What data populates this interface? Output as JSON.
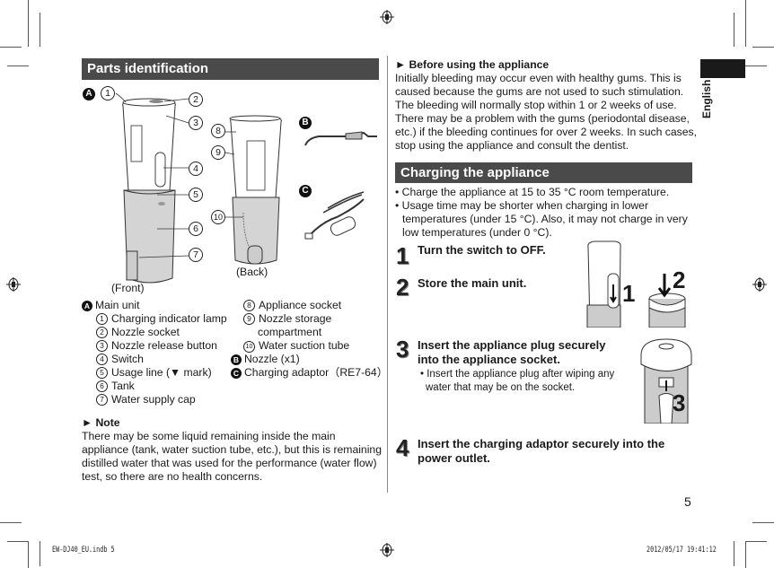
{
  "page": {
    "number": "5",
    "language_tab": "English",
    "footer": {
      "file": "EW-DJ40_EU.indb   5",
      "datetime": "2012/05/17   19:41:12"
    }
  },
  "parts": {
    "heading": "Parts identification",
    "group_labels": {
      "A": "A",
      "B": "B",
      "C": "C"
    },
    "captions": {
      "front": "(Front)",
      "back": "(Back)"
    },
    "callouts": [
      "1",
      "2",
      "3",
      "4",
      "5",
      "6",
      "7",
      "8",
      "9",
      "10"
    ],
    "main_unit_label": "Main unit",
    "items_left": [
      {
        "num": "1",
        "text": "Charging indicator lamp"
      },
      {
        "num": "2",
        "text": "Nozzle socket"
      },
      {
        "num": "3",
        "text": "Nozzle release button"
      },
      {
        "num": "4",
        "text": "Switch"
      },
      {
        "num": "5",
        "text": "Usage line (▼ mark)"
      },
      {
        "num": "6",
        "text": "Tank"
      },
      {
        "num": "7",
        "text": "Water supply cap"
      }
    ],
    "items_right": [
      {
        "num": "8",
        "text": "Appliance socket"
      },
      {
        "num": "9",
        "text": "Nozzle storage",
        "text2": "compartment"
      },
      {
        "num": "10",
        "text": "Water suction tube"
      }
    ],
    "nozzle": {
      "letter": "B",
      "text": "Nozzle (x1)"
    },
    "adaptor": {
      "letter": "C",
      "text": "Charging adaptor（RE7-64）"
    }
  },
  "note": {
    "heading": "► Note",
    "lines": [
      "There may be some liquid remaining inside the main",
      "appliance (tank, water suction tube, etc.), but this is remaining",
      "distilled water that was used for the performance (water flow)",
      "test, so there are no health concerns."
    ]
  },
  "before_use": {
    "heading": "► Before using the appliance",
    "lines": [
      "Initially bleeding may occur even with healthy gums. This is",
      "caused because the gums are not used to such stimulation.",
      "The bleeding will normally stop within 1 or 2 weeks of use.",
      "There may be a problem with the gums (periodontal disease,",
      "etc.) if the bleeding continues for over 2 weeks. In such cases,",
      "stop using the appliance and consult the dentist."
    ]
  },
  "charging": {
    "heading": "Charging the appliance",
    "bullets": [
      {
        "line1": "• Charge the appliance at 15 to 35 °C room temperature."
      },
      {
        "line1": "• Usage time may be shorter when charging in lower",
        "line2": "temperatures (under 15 °C). Also, it may not charge in very",
        "line3": "low temperatures (under 0 °C)."
      }
    ],
    "steps": [
      {
        "num": "1",
        "title": "Turn the switch to OFF."
      },
      {
        "num": "2",
        "title": "Store the main unit."
      },
      {
        "num": "3",
        "title_line1": "Insert the appliance plug securely",
        "title_line2": "into the appliance socket.",
        "sub_line1": "• Insert the appliance plug after wiping any",
        "sub_line2": "water that may be on the socket."
      },
      {
        "num": "4",
        "title_line1": "Insert the charging adaptor securely into the",
        "title_line2": "power outlet."
      }
    ],
    "illustration_labels": [
      "1",
      "2",
      "3"
    ]
  }
}
